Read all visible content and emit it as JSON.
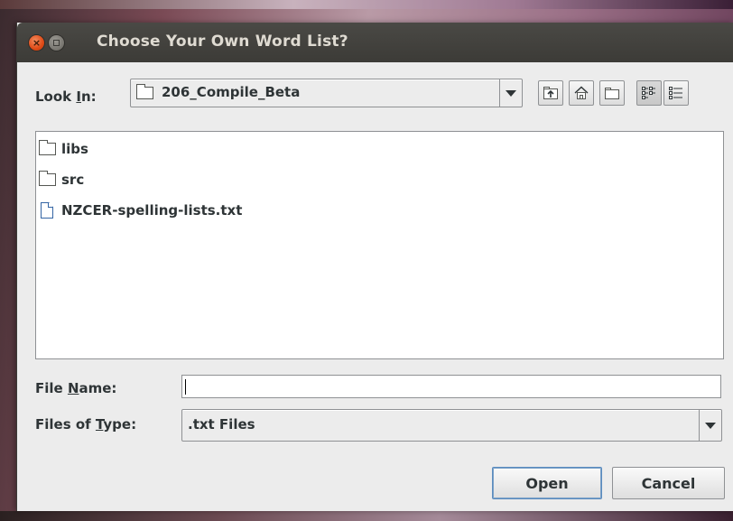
{
  "window": {
    "title": "Choose Your Own Word List?"
  },
  "look_in": {
    "label_pre": "Look ",
    "label_mnemonic": "I",
    "label_post": "n:",
    "value": "206_Compile_Beta"
  },
  "toolbar": {
    "buttons": [
      {
        "icon": "up-one-level-icon"
      },
      {
        "icon": "home-icon"
      },
      {
        "icon": "new-folder-icon"
      },
      {
        "icon": "list-view-icon",
        "active": true
      },
      {
        "icon": "details-view-icon"
      }
    ]
  },
  "files": [
    {
      "name": "libs",
      "kind": "folder"
    },
    {
      "name": "src",
      "kind": "folder"
    },
    {
      "name": "NZCER-spelling-lists.txt",
      "kind": "file"
    }
  ],
  "file_name": {
    "label_pre": "File ",
    "label_mnemonic": "N",
    "label_post": "ame:",
    "value": ""
  },
  "file_type": {
    "label_pre": "Files of ",
    "label_mnemonic": "T",
    "label_post": "ype:",
    "value": ".txt Files"
  },
  "actions": {
    "open_label": "Open",
    "cancel_label": "Cancel"
  }
}
